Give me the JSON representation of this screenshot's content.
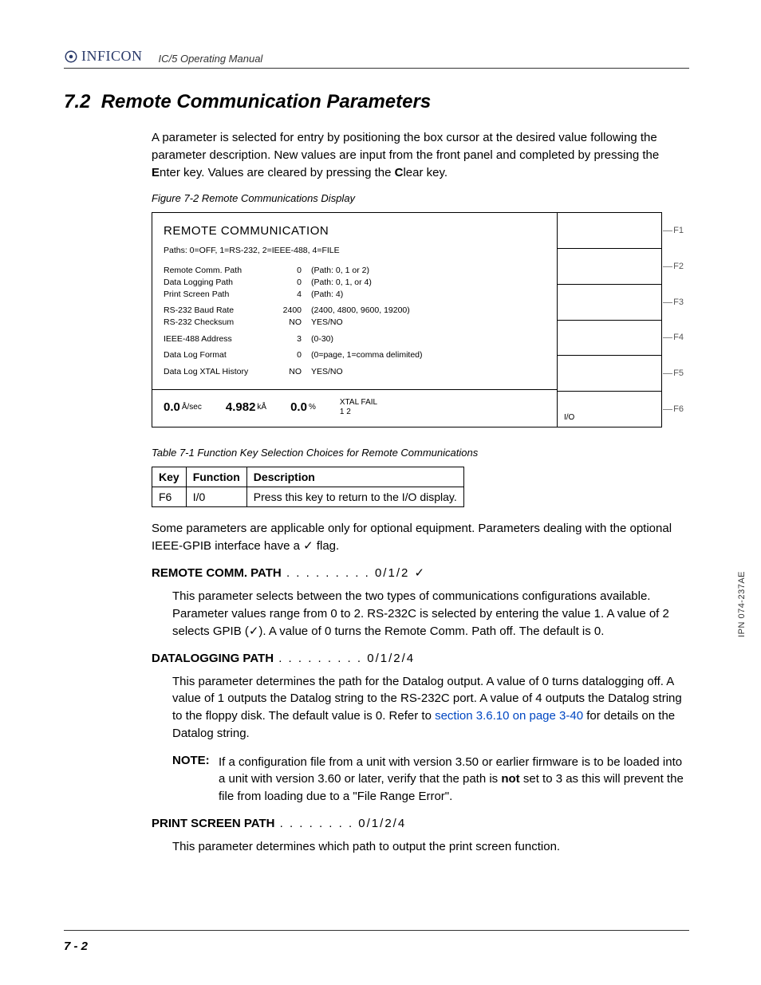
{
  "header": {
    "brand": "INFICON",
    "manual": "IC/5 Operating Manual"
  },
  "section": {
    "number": "7.2",
    "title": "Remote Communication Parameters"
  },
  "intro": {
    "p1_a": "A parameter is selected for entry by positioning the box cursor at the desired value following the parameter description. New values are input from the front panel and completed by pressing the ",
    "enter": "E",
    "p1_b": "nter key. Values are cleared by pressing the ",
    "clear": "C",
    "p1_c": "lear key."
  },
  "figure": {
    "caption": "Figure 7-2  Remote Communications Display",
    "screen_title": "REMOTE COMMUNICATION",
    "paths_line": "Paths:  0=OFF,  1=RS-232,  2=IEEE-488,  4=FILE",
    "rows": [
      {
        "label": "Remote Comm. Path",
        "val": "0",
        "hint": "(Path: 0, 1 or 2)"
      },
      {
        "label": "Data Logging Path",
        "val": "0",
        "hint": "(Path: 0, 1, or 4)"
      },
      {
        "label": "Print Screen Path",
        "val": "4",
        "hint": "(Path: 4)"
      }
    ],
    "rows2": [
      {
        "label": "RS-232 Baud Rate",
        "val": "2400",
        "hint": "(2400, 4800, 9600, 19200)"
      },
      {
        "label": "RS-232 Checksum",
        "val": "NO",
        "hint": "YES/NO"
      }
    ],
    "rows3": [
      {
        "label": "IEEE-488 Address",
        "val": "3",
        "hint": "(0-30)"
      }
    ],
    "rows4": [
      {
        "label": "Data Log Format",
        "val": "0",
        "hint": "(0=page, 1=comma delimited)"
      }
    ],
    "rows5": [
      {
        "label": "Data Log XTAL History",
        "val": "NO",
        "hint": "YES/NO"
      }
    ],
    "status": {
      "rate_val": "0.0",
      "rate_unit": "Å/sec",
      "thk_val": "4.982",
      "thk_unit": "kÅ",
      "pct_val": "0.0",
      "pct_unit": "%",
      "xtal_label": "XTAL FAIL",
      "xtal_sub": "1 2"
    },
    "softkeys": [
      "F1",
      "F2",
      "F3",
      "F4",
      "F5",
      "F6"
    ],
    "softkey_label_f6": "I/O"
  },
  "table": {
    "caption": "Table 7-1  Function Key Selection Choices for Remote Communications",
    "headers": [
      "Key",
      "Function",
      "Description"
    ],
    "row": {
      "key": "F6",
      "func": "I/0",
      "desc": "Press this key to return to the I/O display."
    }
  },
  "after_table": "Some parameters are applicable only for optional equipment. Parameters dealing with the optional IEEE-GPIB interface have a ✓ flag.",
  "defs": {
    "remote": {
      "head_a": "REMOTE COMM. PATH",
      "head_b": " . . . . . . . . . 0/1/2 ✓",
      "body": "This parameter selects between the two types of communications configurations available. Parameter values range from 0 to 2. RS-232C is selected by entering the value 1. A value of 2 selects GPIB (✓). A value of 0 turns the Remote Comm. Path off. The default is 0."
    },
    "datalog": {
      "head_a": "DATALOGGING PATH",
      "head_b": "   . . . . . . . . . 0/1/2/4",
      "body_a": "This parameter determines the path for the Datalog output. A value of 0 turns datalogging off. A value of 1 outputs the Datalog string to the RS-232C port. A value of 4 outputs the Datalog string to the floppy disk. The default value is 0. Refer to ",
      "link": "section 3.6.10 on page 3-40",
      "body_b": " for details on the Datalog string.",
      "note_label": "NOTE:",
      "note_a": "If a configuration file from a unit with version 3.50 or earlier firmware is to be loaded into a unit with version 3.60 or later, verify that the path is ",
      "note_bold": "not",
      "note_b": " set to 3 as this will prevent the file from loading due to a \"File Range Error\"."
    },
    "print": {
      "head_a": "PRINT SCREEN PATH",
      "head_b": "     . . . . . . . . 0/1/2/4",
      "body": "This parameter determines which path to output the print screen function."
    }
  },
  "side_ipn": "IPN 074-237AE",
  "page_num": "7 - 2"
}
